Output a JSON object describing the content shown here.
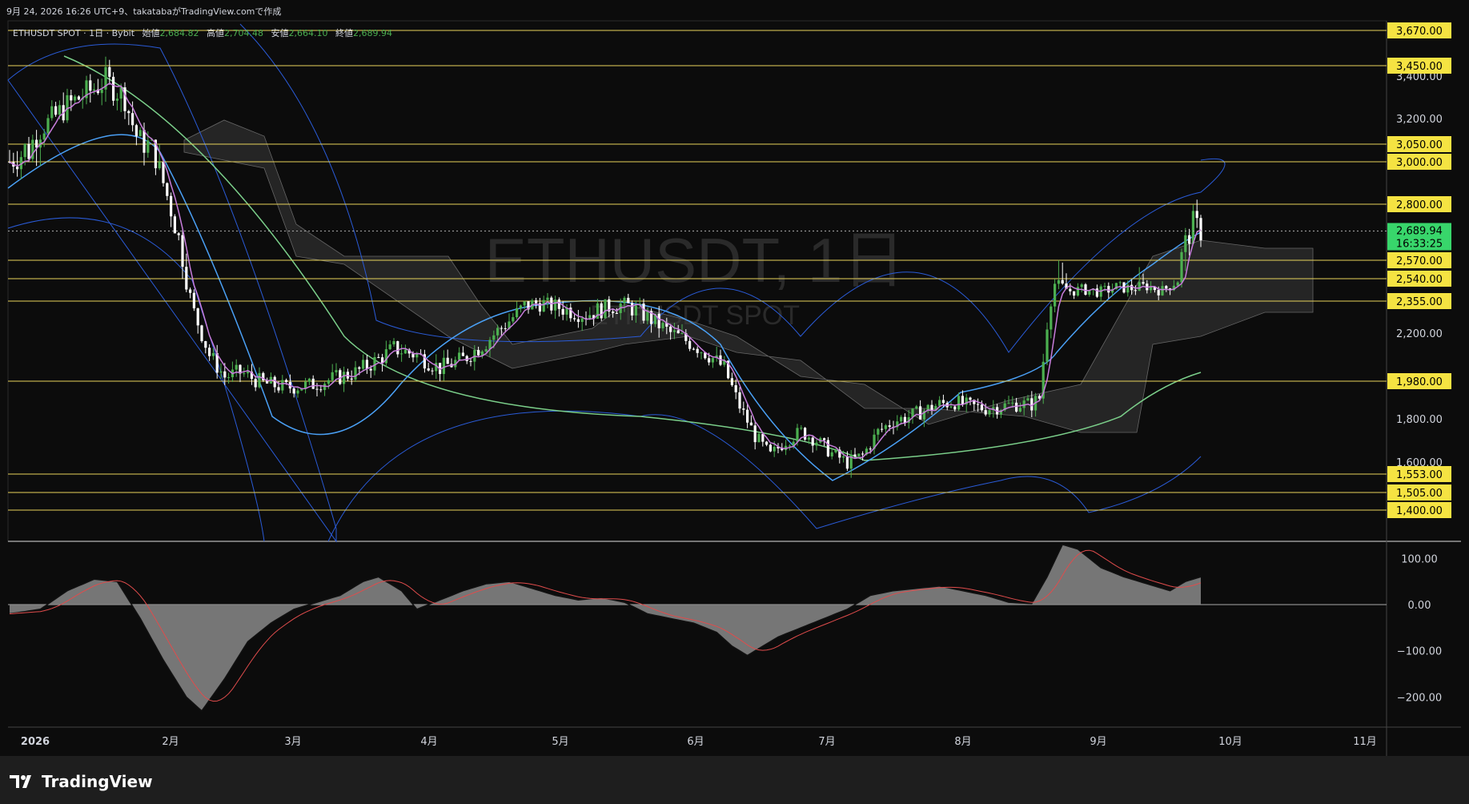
{
  "header": {
    "snapshot_line": "9月 24, 2026 16:26 UTC+9、takatabaがTradingView.comで作成",
    "symbol_line": "ETHUSDT SPOT · 1日 · Bybit",
    "ohlc": [
      {
        "label": "始値",
        "value": "2,684.82"
      },
      {
        "label": "高値",
        "value": "2,704.48"
      },
      {
        "label": "安値",
        "value": "2,664.10"
      },
      {
        "label": "終値",
        "value": "2,689.94"
      }
    ]
  },
  "watermark": {
    "main": "ETHUSDT, 1日",
    "sub": "ETHUSDT SPOT"
  },
  "price_badge": {
    "price": "2,689.94",
    "countdown": "16:33:25"
  },
  "brand": {
    "name": "TradingView"
  },
  "colors": {
    "background": "#0c0c0c",
    "up": "#4caf50",
    "down": "#ffffff",
    "level_line": "#e8d25a",
    "level_label_bg": "#f5e342",
    "bollinger": "#2a5bd7",
    "ma_fast": "#c77ddb",
    "ma_mid": "#4aa0f5",
    "ma_slow": "#7bcf8a",
    "cloud": "#3a3a3a",
    "macd_hist": "#8a8a8a",
    "macd_signal": "#e04c4c",
    "price_badge_bg": "#38d66b"
  },
  "chart_data": [
    {
      "type": "candlestick",
      "title": "ETHUSDT, 1日",
      "x_axis_labels": [
        "2026",
        "2月",
        "3月",
        "4月",
        "5月",
        "6月",
        "7月",
        "8月",
        "9月",
        "10月",
        "11月"
      ],
      "y_ticks": [
        "3,400.00",
        "3,200.00",
        "2,200.00",
        "1,800.00",
        "1,600.00"
      ],
      "ylim": [
        1240,
        3700
      ],
      "levels": [
        {
          "value": 3670,
          "label": "3,670.00"
        },
        {
          "value": 3450,
          "label": "3,450.00"
        },
        {
          "value": 3050,
          "label": "3,050.00"
        },
        {
          "value": 3000,
          "label": "3,000.00"
        },
        {
          "value": 2800,
          "label": "2,800.00"
        },
        {
          "value": 2570,
          "label": "2,570.00"
        },
        {
          "value": 2540,
          "label": "2,540.00"
        },
        {
          "value": 2355,
          "label": "2,355.00"
        },
        {
          "value": 1980,
          "label": "1,980.00"
        },
        {
          "value": 1553,
          "label": "1,553.00"
        },
        {
          "value": 1505,
          "label": "1,505.00"
        },
        {
          "value": 1400,
          "label": "1,400.00"
        }
      ],
      "last_price": 2689.94,
      "close_path": [
        [
          0,
          3000
        ],
        [
          5,
          3040
        ],
        [
          10,
          3180
        ],
        [
          15,
          3260
        ],
        [
          20,
          3320
        ],
        [
          25,
          3380
        ],
        [
          30,
          3300
        ],
        [
          33,
          3100
        ],
        [
          38,
          3020
        ],
        [
          40,
          2900
        ],
        [
          45,
          2600
        ],
        [
          48,
          2300
        ],
        [
          52,
          2100
        ],
        [
          56,
          2000
        ],
        [
          60,
          2020
        ],
        [
          66,
          1970
        ],
        [
          72,
          1950
        ],
        [
          78,
          1960
        ],
        [
          84,
          1990
        ],
        [
          90,
          2020
        ],
        [
          96,
          2080
        ],
        [
          100,
          2130
        ],
        [
          106,
          2100
        ],
        [
          112,
          2040
        ],
        [
          118,
          2080
        ],
        [
          124,
          2160
        ],
        [
          130,
          2260
        ],
        [
          134,
          2330
        ],
        [
          138,
          2350
        ],
        [
          144,
          2320
        ],
        [
          150,
          2290
        ],
        [
          156,
          2330
        ],
        [
          160,
          2340
        ],
        [
          166,
          2280
        ],
        [
          172,
          2200
        ],
        [
          178,
          2150
        ],
        [
          182,
          2100
        ],
        [
          186,
          2040
        ],
        [
          190,
          1860
        ],
        [
          194,
          1720
        ],
        [
          198,
          1630
        ],
        [
          202,
          1700
        ],
        [
          206,
          1740
        ],
        [
          210,
          1700
        ],
        [
          214,
          1640
        ],
        [
          218,
          1600
        ],
        [
          222,
          1630
        ],
        [
          226,
          1740
        ],
        [
          230,
          1790
        ],
        [
          234,
          1810
        ],
        [
          238,
          1840
        ],
        [
          242,
          1870
        ],
        [
          246,
          1880
        ],
        [
          250,
          1860
        ],
        [
          254,
          1850
        ],
        [
          258,
          1860
        ],
        [
          262,
          1870
        ],
        [
          266,
          1870
        ],
        [
          268,
          1900
        ],
        [
          270,
          2250
        ],
        [
          272,
          2500
        ],
        [
          276,
          2440
        ],
        [
          280,
          2450
        ],
        [
          284,
          2430
        ],
        [
          288,
          2470
        ],
        [
          292,
          2460
        ],
        [
          296,
          2480
        ],
        [
          300,
          2440
        ],
        [
          304,
          2530
        ],
        [
          306,
          2640
        ],
        [
          308,
          2720
        ],
        [
          310,
          2690
        ]
      ],
      "ohlc_last": {
        "open": 2684.82,
        "high": 2704.48,
        "low": 2664.1,
        "close": 2689.94
      }
    },
    {
      "type": "area",
      "title": "",
      "y_ticks": [
        "100.00",
        "0.00",
        "−100.00",
        "−200.00"
      ],
      "ylim": [
        -260,
        130
      ],
      "macd_path": [
        [
          0,
          -20
        ],
        [
          8,
          -10
        ],
        [
          15,
          30
        ],
        [
          22,
          55
        ],
        [
          28,
          50
        ],
        [
          34,
          -30
        ],
        [
          40,
          -120
        ],
        [
          46,
          -200
        ],
        [
          50,
          -230
        ],
        [
          56,
          -160
        ],
        [
          62,
          -80
        ],
        [
          68,
          -40
        ],
        [
          74,
          -10
        ],
        [
          80,
          5
        ],
        [
          86,
          20
        ],
        [
          92,
          50
        ],
        [
          96,
          60
        ],
        [
          102,
          30
        ],
        [
          106,
          -10
        ],
        [
          112,
          10
        ],
        [
          118,
          30
        ],
        [
          124,
          45
        ],
        [
          130,
          50
        ],
        [
          136,
          35
        ],
        [
          142,
          20
        ],
        [
          148,
          10
        ],
        [
          154,
          15
        ],
        [
          160,
          5
        ],
        [
          166,
          -20
        ],
        [
          172,
          -30
        ],
        [
          178,
          -40
        ],
        [
          184,
          -60
        ],
        [
          188,
          -90
        ],
        [
          192,
          -110
        ],
        [
          196,
          -90
        ],
        [
          200,
          -70
        ],
        [
          206,
          -50
        ],
        [
          212,
          -30
        ],
        [
          218,
          -10
        ],
        [
          224,
          20
        ],
        [
          230,
          30
        ],
        [
          236,
          35
        ],
        [
          242,
          40
        ],
        [
          248,
          30
        ],
        [
          254,
          20
        ],
        [
          260,
          5
        ],
        [
          266,
          2
        ],
        [
          270,
          60
        ],
        [
          274,
          130
        ],
        [
          278,
          120
        ],
        [
          284,
          80
        ],
        [
          290,
          60
        ],
        [
          296,
          45
        ],
        [
          302,
          30
        ],
        [
          306,
          50
        ],
        [
          310,
          60
        ]
      ]
    }
  ]
}
